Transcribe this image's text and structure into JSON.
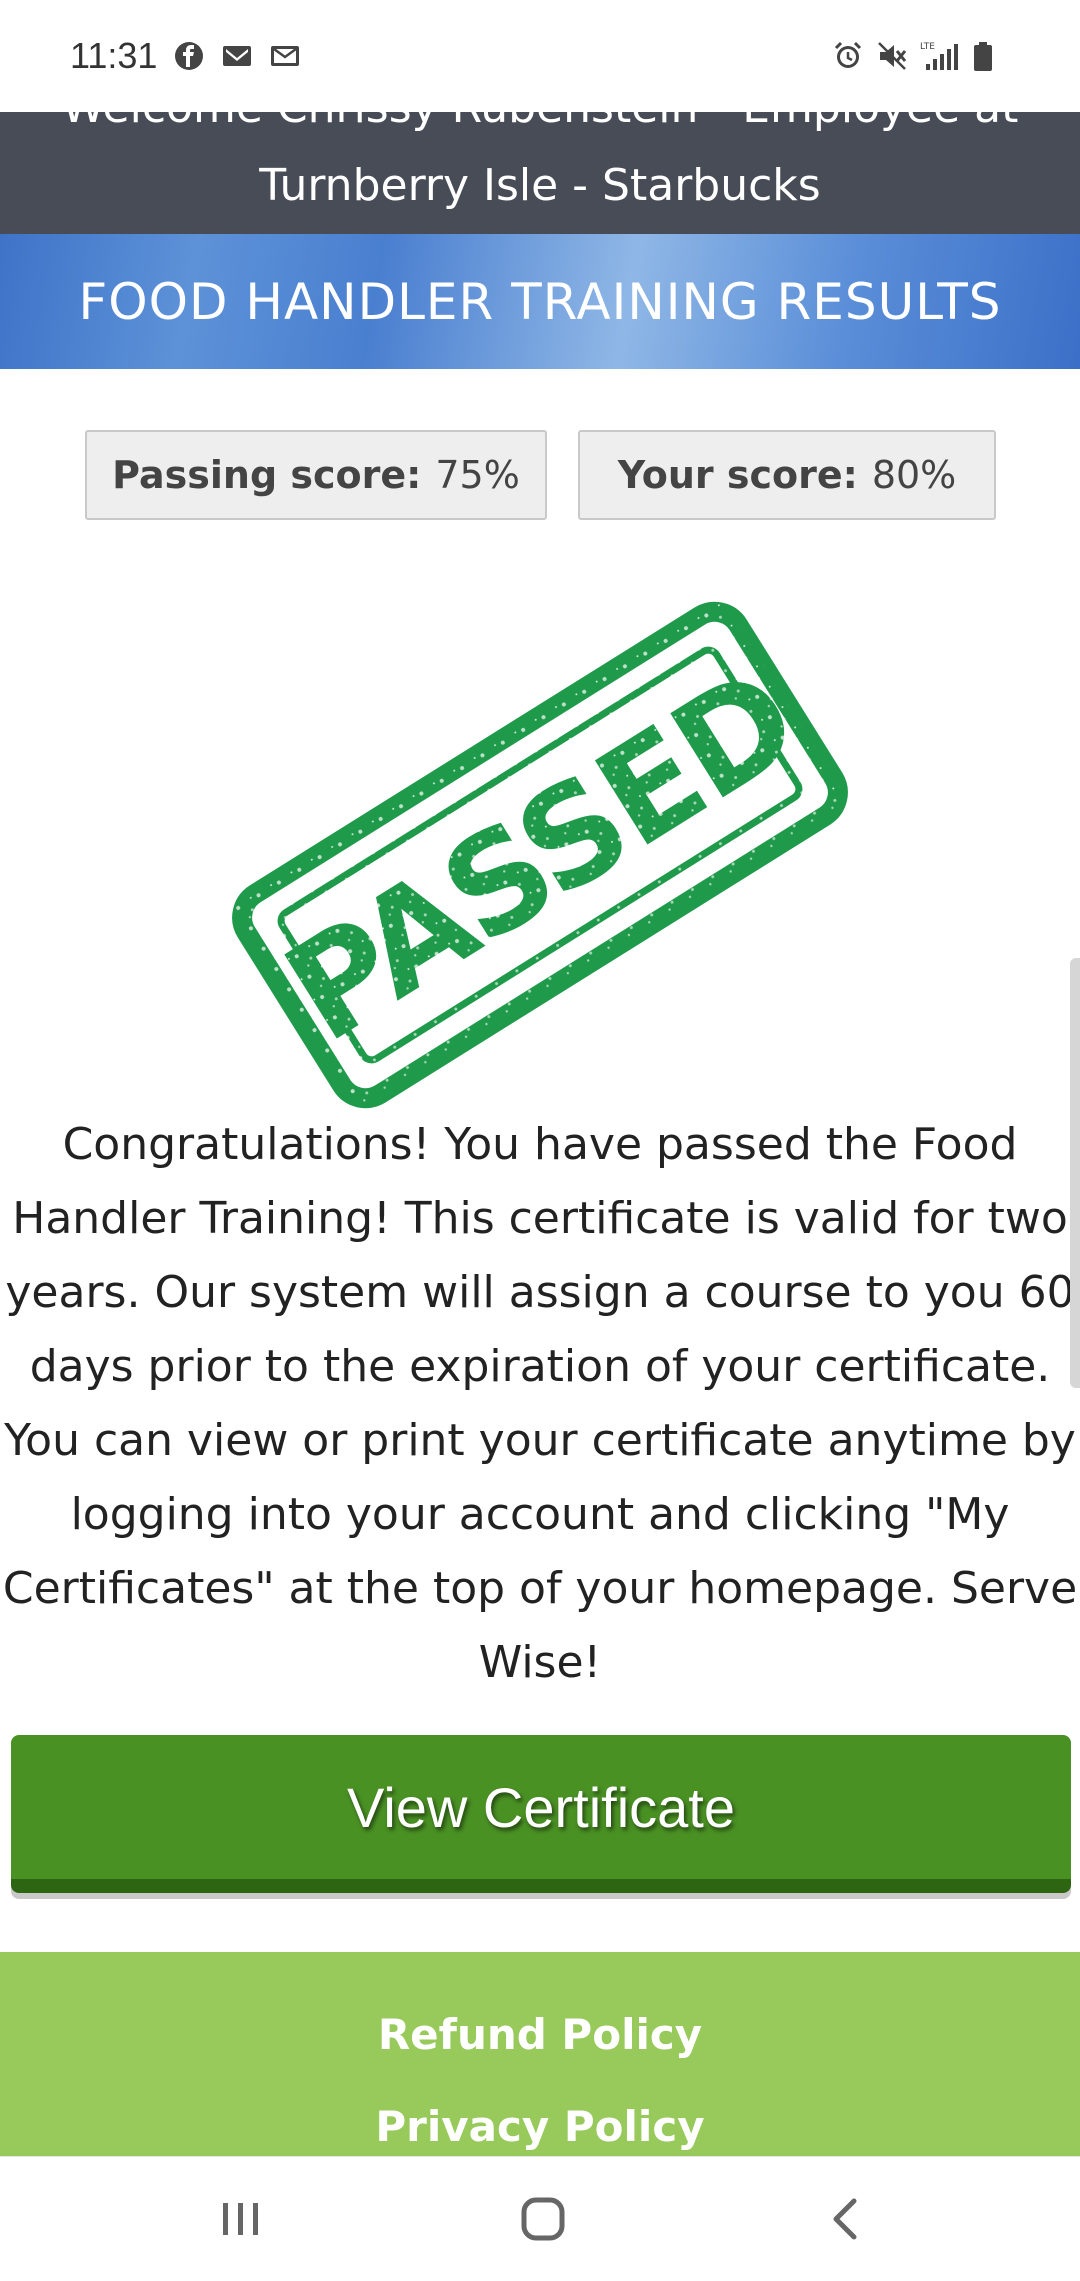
{
  "status_bar": {
    "time": "11:31",
    "left_icons": [
      "facebook-icon",
      "gmail-icon",
      "mail-icon"
    ],
    "right_icons": [
      "alarm-icon",
      "mute-icon",
      "lte-signal-icon",
      "battery-icon"
    ],
    "network_label": "LTE"
  },
  "header": {
    "welcome_line1": "Welcome Chrissy Rubenstein - Employee at",
    "welcome_line2": "Turnberry Isle - Starbucks",
    "banner_title": "FOOD HANDLER TRAINING RESULTS",
    "colors": {
      "header_bg": "#474c56",
      "banner_blue": "#4a7fd0"
    }
  },
  "scores": {
    "passing_label": "Passing score:",
    "passing_value": "75%",
    "your_label": "Your score:",
    "your_value": "80%"
  },
  "stamp": {
    "text": "PASSED",
    "color": "#1e9a4a"
  },
  "message": {
    "text": "Congratulations! You have passed the Food Handler Training! This certificate is valid for two years. Our system will assign a course to you 60 days prior to the expiration of your certificate. You can view or print your certificate anytime by logging into your account and clicking \"My Certificates\" at the top of your homepage. Serve Wise!"
  },
  "actions": {
    "view_certificate_label": "View Certificate",
    "button_color": "#4a9124"
  },
  "footer": {
    "refund_label": "Refund Policy",
    "privacy_label": "Privacy Policy",
    "bg_color": "#97c95b"
  },
  "nav_bar": {
    "icons": [
      "recents-icon",
      "home-icon",
      "back-icon"
    ]
  }
}
